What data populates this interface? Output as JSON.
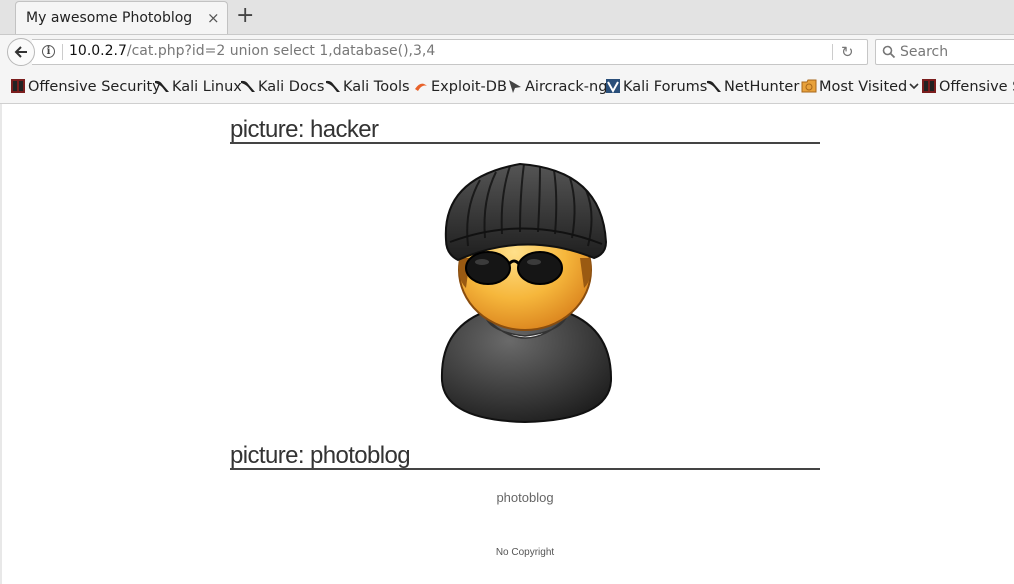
{
  "browser": {
    "tab_title": "My awesome Photoblog",
    "tab_close": "×",
    "new_tab": "+",
    "url_host": "10.0.2.7",
    "url_path": "/cat.php?id=2 union select 1,database(),3,4",
    "search_placeholder": "Search"
  },
  "bookmarks": [
    {
      "label": "Offensive Security",
      "icon": "offsec-icon"
    },
    {
      "label": "Kali Linux",
      "icon": "kali-dragon-icon"
    },
    {
      "label": "Kali Docs",
      "icon": "kali-dragon-icon"
    },
    {
      "label": "Kali Tools",
      "icon": "kali-dragon-icon"
    },
    {
      "label": "Exploit-DB",
      "icon": "exploitdb-icon"
    },
    {
      "label": "Aircrack-ng",
      "icon": "aircrack-icon"
    },
    {
      "label": "Kali Forums",
      "icon": "kali-forums-icon"
    },
    {
      "label": "NetHunter",
      "icon": "kali-dragon-icon"
    },
    {
      "label": "Most Visited",
      "icon": "folder-icon"
    },
    {
      "label": "Offensive Security",
      "icon": "offsec-icon"
    }
  ],
  "page": {
    "heading_1": "picture: hacker",
    "heading_2": "picture: photoblog",
    "image_2_alt": "photoblog",
    "footer": "No Copyright"
  },
  "colors": {
    "tabbar_bg": "#e3e3e3",
    "toolbar_bg": "#f5f5f5",
    "heading_rule": "#444444"
  }
}
